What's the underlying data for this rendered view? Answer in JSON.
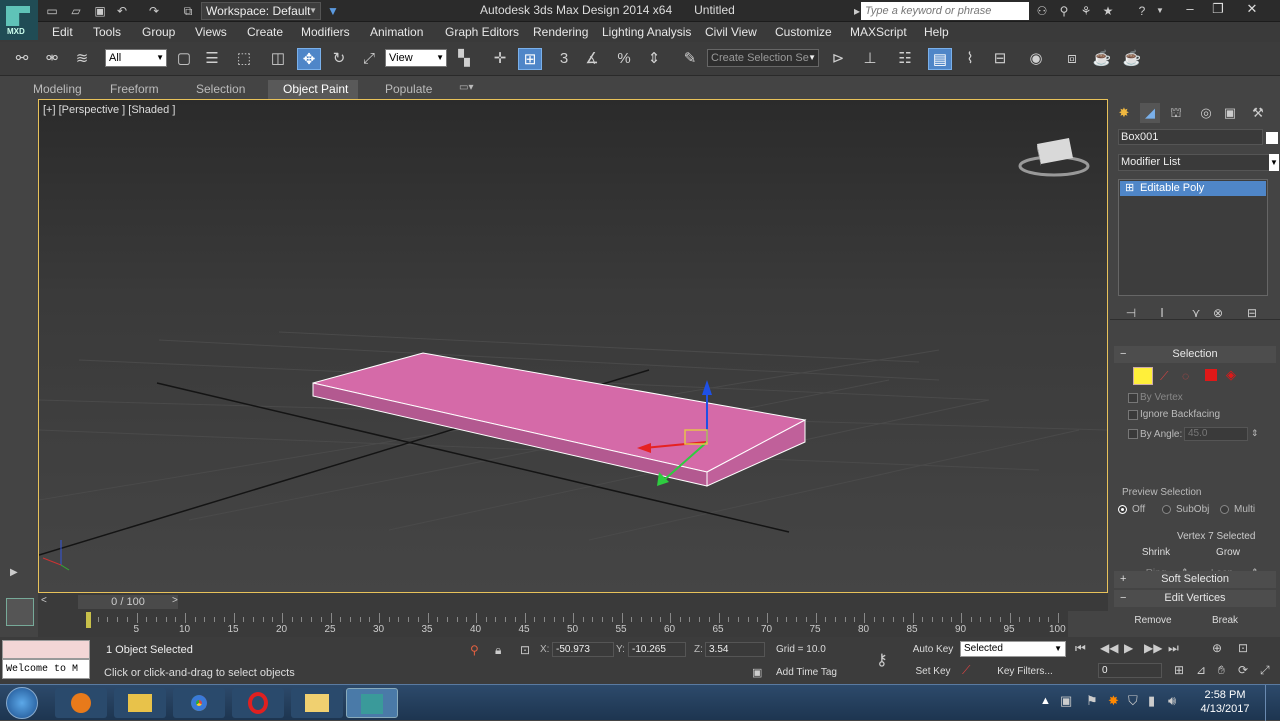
{
  "title_bar": {
    "workspace": "Workspace: Default",
    "app_title": "Autodesk 3ds Max Design 2014 x64",
    "doc_title": "Untitled",
    "search_placeholder": "Type a keyword or phrase"
  },
  "logo": {
    "text": "MXD"
  },
  "menu": [
    "Edit",
    "Tools",
    "Group",
    "Views",
    "Create",
    "Modifiers",
    "Animation",
    "Graph Editors",
    "Rendering",
    "Lighting Analysis",
    "Civil View",
    "Customize",
    "MAXScript",
    "Help"
  ],
  "toolbar": {
    "selection_filter": "All",
    "ref_coord": "View",
    "named_selection": "Create Selection Se"
  },
  "ribbon_tabs": [
    "Modeling",
    "Freeform",
    "Selection",
    "Object Paint",
    "Populate"
  ],
  "ribbon_active": "Object Paint",
  "viewport": {
    "label": "[+] [Perspective ] [Shaded ]"
  },
  "command_panel": {
    "object_name": "Box001",
    "modifier_list": "Modifier List",
    "stack_item": "Editable Poly",
    "selection_rollout": "Selection",
    "by_vertex": "By Vertex",
    "ignore_backfacing": "Ignore Backfacing",
    "by_angle": "By Angle:",
    "angle_value": "45.0",
    "shrink": "Shrink",
    "grow": "Grow",
    "ring": "Ring",
    "loop": "Loop",
    "preview_selection": "Preview Selection",
    "preview_off": "Off",
    "preview_subobj": "SubObj",
    "preview_multi": "Multi",
    "selection_status": "Vertex 7 Selected",
    "soft_selection": "Soft Selection",
    "edit_vertices": "Edit Vertices",
    "remove": "Remove",
    "break": "Break"
  },
  "timeline": {
    "frame_display": "0 / 100",
    "ticks": [
      "5",
      "10",
      "15",
      "20",
      "25",
      "30",
      "35",
      "40",
      "45",
      "50",
      "55",
      "60",
      "65",
      "70",
      "75",
      "80",
      "85",
      "90",
      "95",
      "100"
    ]
  },
  "status_bar": {
    "maxscript": "Welcome to M",
    "selected": "1 Object Selected",
    "prompt": "Click or click-and-drag to select objects",
    "x_label": "X:",
    "x_value": "-50.973",
    "y_label": "Y:",
    "y_value": "-10.265",
    "z_label": "Z:",
    "z_value": "3.54",
    "grid": "Grid = 10.0",
    "add_time_tag": "Add Time Tag",
    "auto_key": "Auto Key",
    "set_key": "Set Key",
    "key_mode": "Selected",
    "key_filters": "Key Filters...",
    "frame": "0"
  },
  "taskbar": {
    "time": "2:58 PM",
    "date": "4/13/2017"
  }
}
